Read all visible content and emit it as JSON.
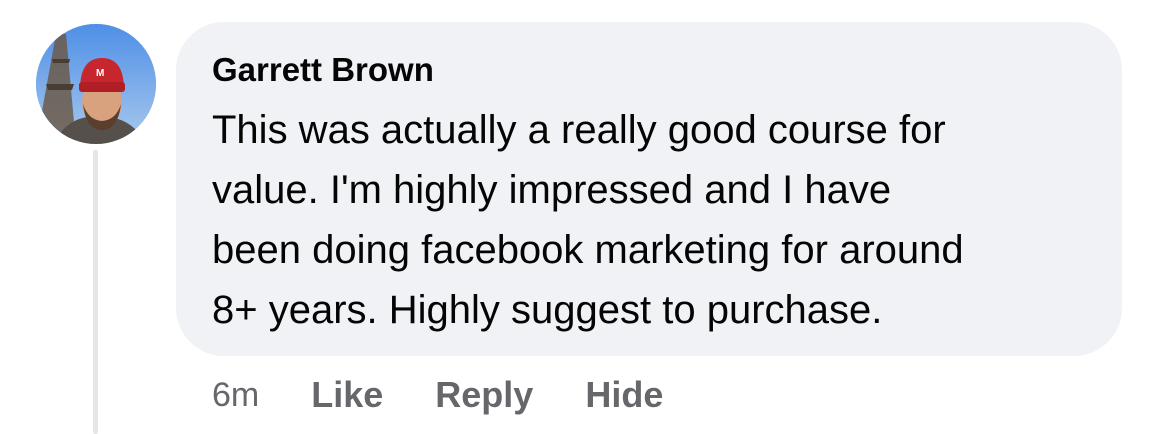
{
  "comment": {
    "author": "Garrett Brown",
    "lines": [
      "This was actually a really good course for",
      "value. I'm highly impressed and I have",
      "been doing facebook marketing for around",
      "8+ years. Highly suggest to purchase."
    ]
  },
  "actions": {
    "timestamp": "6m",
    "like_label": "Like",
    "reply_label": "Reply",
    "hide_label": "Hide"
  },
  "colors": {
    "bubble_bg": "#f0f2f5",
    "text": "#050505",
    "secondary_text": "#65676b",
    "thread_line": "#e4e6eb"
  }
}
